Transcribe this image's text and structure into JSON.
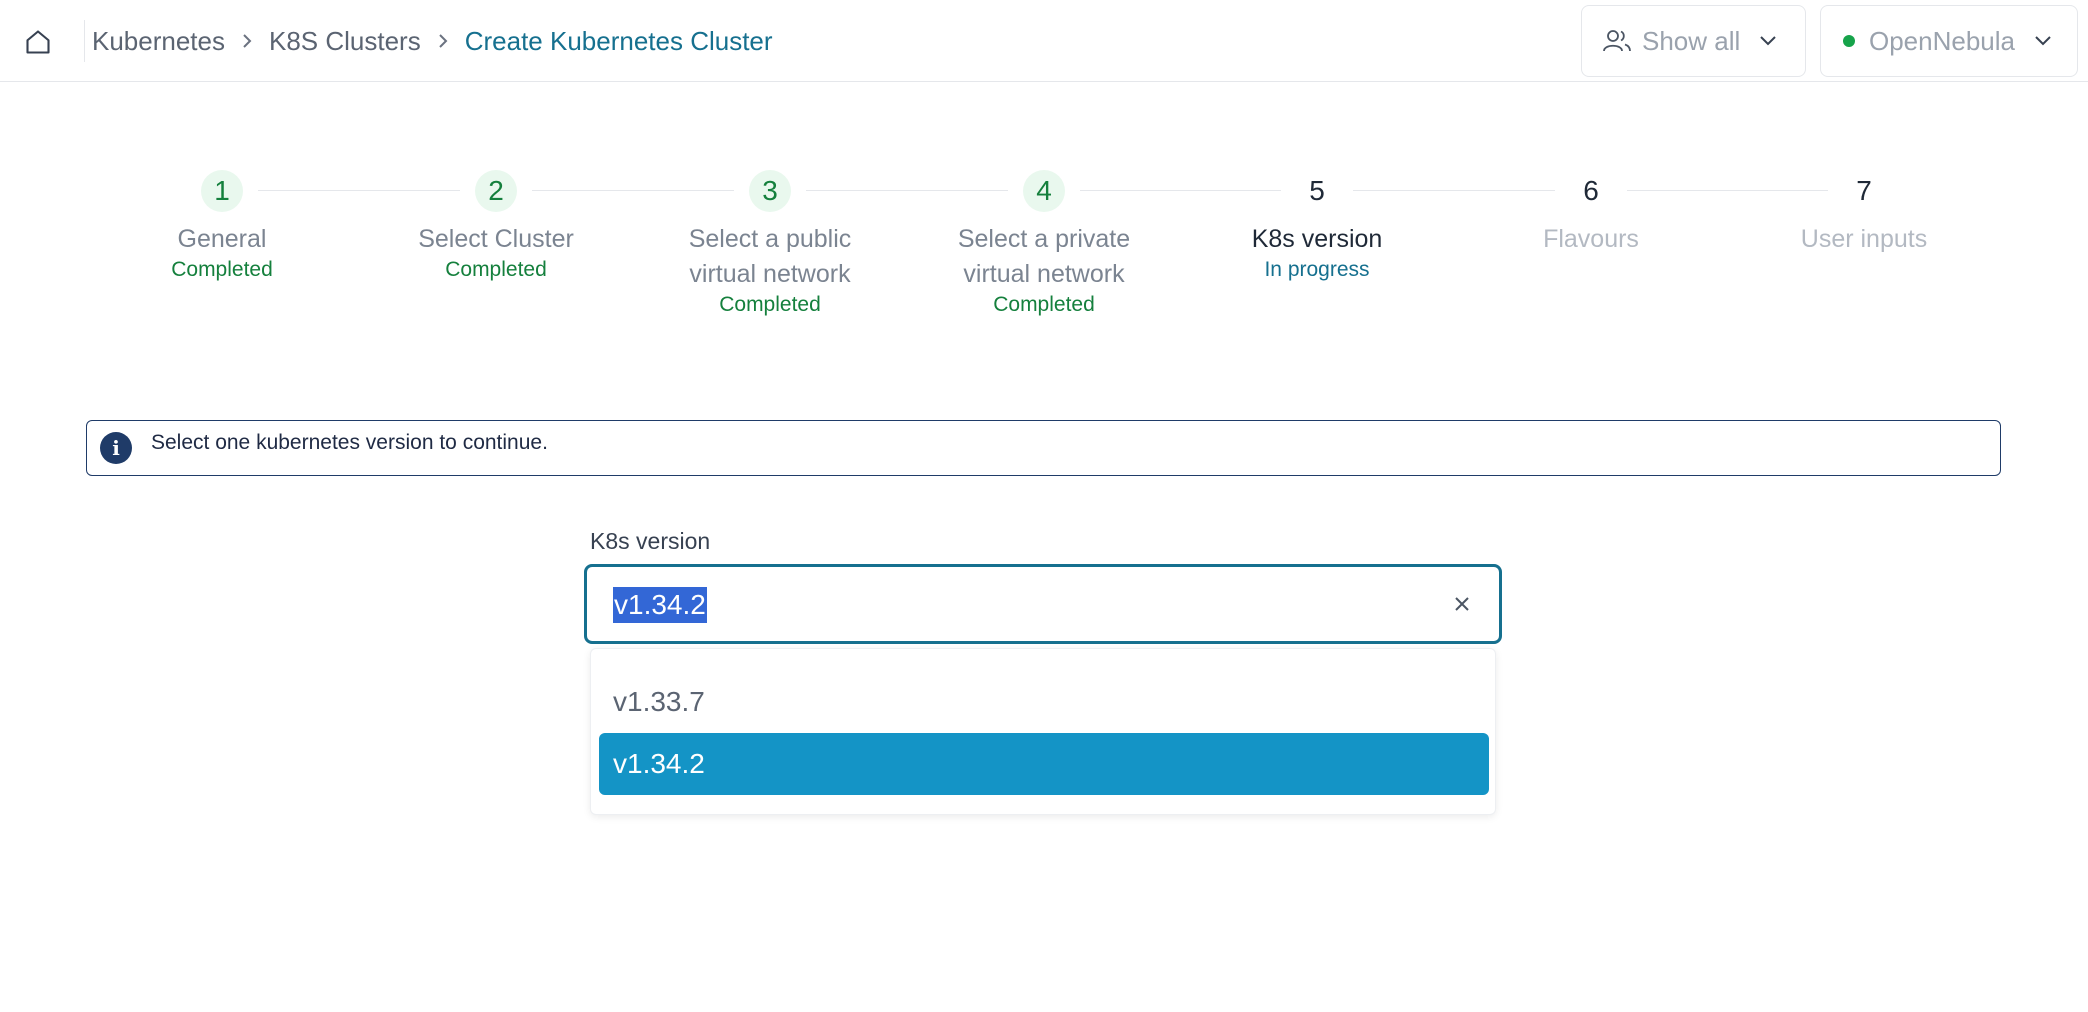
{
  "breadcrumb": {
    "items": [
      "Kubernetes",
      "K8S Clusters"
    ],
    "current": "Create Kubernetes Cluster"
  },
  "header": {
    "group_filter": {
      "label": "Show all",
      "icon": "users-icon"
    },
    "zone_selector": {
      "label": "OpenNebula",
      "status_color": "#16a34a"
    }
  },
  "stepper": {
    "steps": [
      {
        "number": "1",
        "label": "General",
        "status": "Completed",
        "state": "done"
      },
      {
        "number": "2",
        "label": "Select Cluster",
        "status": "Completed",
        "state": "done"
      },
      {
        "number": "3",
        "label": "Select a public virtual network",
        "status": "Completed",
        "state": "done"
      },
      {
        "number": "4",
        "label": "Select a private virtual network",
        "status": "Completed",
        "state": "done"
      },
      {
        "number": "5",
        "label": "K8s version",
        "status": "In progress",
        "state": "active"
      },
      {
        "number": "6",
        "label": "Flavours",
        "status": "",
        "state": "todo"
      },
      {
        "number": "7",
        "label": "User inputs",
        "status": "",
        "state": "todo"
      }
    ]
  },
  "info": {
    "icon": "info-icon",
    "message": "Select one kubernetes version to continue."
  },
  "form": {
    "k8s_version": {
      "label": "K8s version",
      "value": "v1.34.2",
      "options": [
        "v1.33.7",
        "v1.34.2"
      ],
      "selected_index": 1
    }
  },
  "colors": {
    "accent": "#16708f",
    "completed": "#15803d",
    "selected_option": "#1494c6",
    "info_border": "#1f3b68"
  }
}
